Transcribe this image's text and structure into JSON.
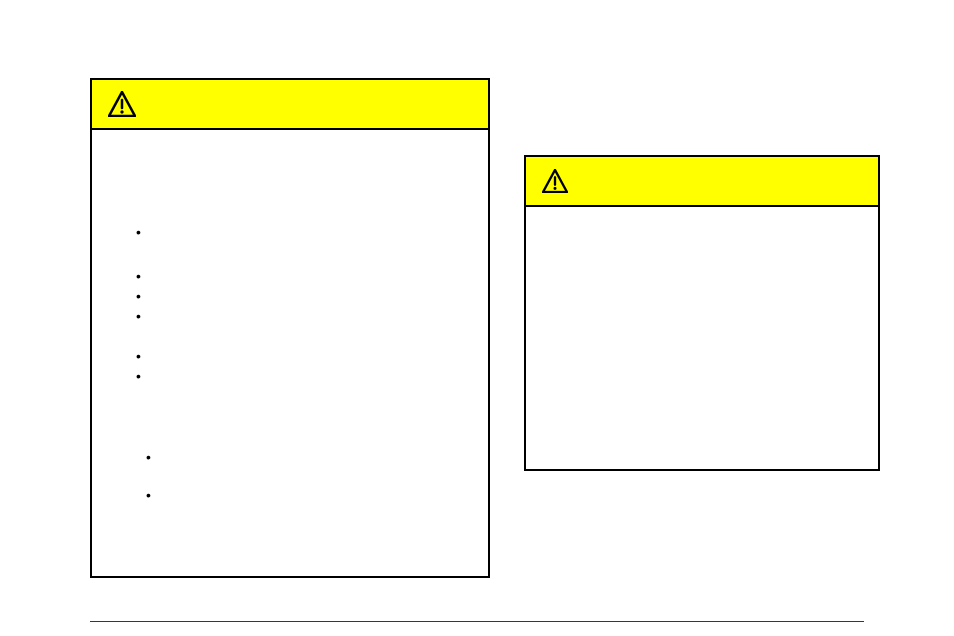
{
  "panels": {
    "left": {
      "icon": "warning-icon",
      "bullets_group_a": [
        "•",
        "•",
        "•",
        "•",
        "•",
        "•"
      ],
      "bullets_group_b": [
        "•",
        "•"
      ]
    },
    "right": {
      "icon": "warning-icon"
    }
  },
  "divider": {
    "color": "#2222dd"
  }
}
